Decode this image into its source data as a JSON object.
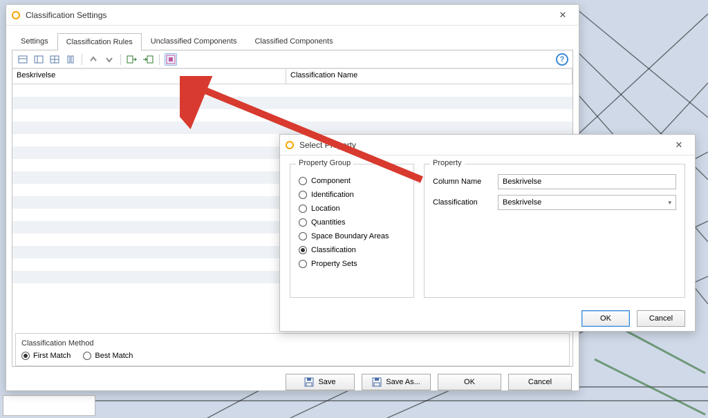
{
  "mainWindow": {
    "title": "Classification Settings",
    "tabs": {
      "settings": "Settings",
      "rules": "Classification Rules",
      "unclassified": "Unclassified Components",
      "classified": "Classified Components"
    },
    "table": {
      "col1": "Beskrivelse",
      "col2": "Classification Name"
    },
    "classificationMethod": {
      "label": "Classification Method",
      "first": "First Match",
      "best": "Best Match"
    },
    "buttons": {
      "save": "Save",
      "saveAs": "Save As...",
      "ok": "OK",
      "cancel": "Cancel"
    }
  },
  "popup": {
    "title": "Select Property",
    "group1": {
      "label": "Property Group",
      "options": {
        "component": "Component",
        "identification": "Identification",
        "location": "Location",
        "quantities": "Quantities",
        "sba": "Space Boundary Areas",
        "classification": "Classification",
        "psets": "Property Sets"
      }
    },
    "group2": {
      "label": "Property",
      "colName": "Column Name",
      "colVal": "Beskrivelse",
      "classLabel": "Classification",
      "classVal": "Beskrivelse"
    },
    "buttons": {
      "ok": "OK",
      "cancel": "Cancel"
    }
  },
  "chart_data": null
}
